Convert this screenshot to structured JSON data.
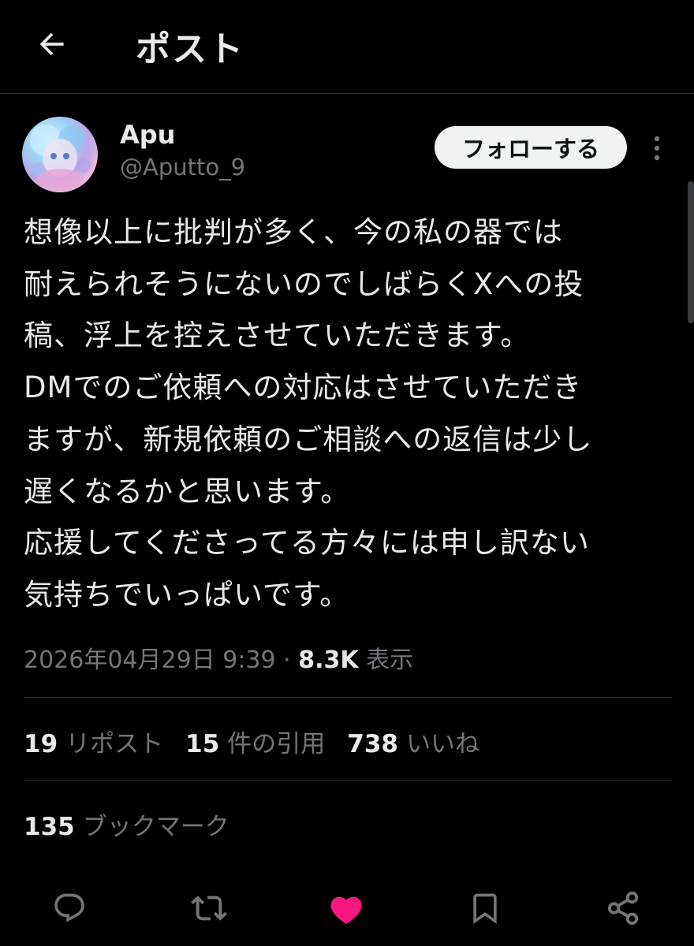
{
  "header": {
    "title": "ポスト",
    "back_icon": "arrow-left-icon"
  },
  "author": {
    "display_name": "Apu",
    "handle": "@Aputto_9",
    "follow_label": "フォローする",
    "more_icon": "more-vertical-icon"
  },
  "post": {
    "text": "想像以上に批判が多く、今の私の器では\n耐えられそうにないのでしばらくXへの投\n稿、浮上を控えさせていただきます。\nDMでのご依頼への対応はさせていただき\nますが、新規依頼のご相談への返信は少し\n遅くなるかと思います。\n応援してくださってる方々には申し訳ない\n気持ちでいっぱいです。",
    "timestamp": "2026年04月29日 9:39",
    "separator": " · ",
    "views_count": "8.3K",
    "views_label": "表示"
  },
  "stats": {
    "reposts_count": "19",
    "reposts_label": "リポスト",
    "quotes_count": "15",
    "quotes_label": "件の引用",
    "likes_count": "738",
    "likes_label": "いいね",
    "bookmarks_count": "135",
    "bookmarks_label": "ブックマーク"
  },
  "actions": [
    {
      "icon": "reply-icon"
    },
    {
      "icon": "repost-icon"
    },
    {
      "icon": "heart-filled-icon",
      "color": "#f91880"
    },
    {
      "icon": "bookmark-icon"
    },
    {
      "icon": "share-icon"
    }
  ],
  "colors": {
    "background": "#000000",
    "text_primary": "#e7e9ea",
    "text_secondary": "#71767b",
    "like_active": "#f91880",
    "divider": "#2f3336"
  }
}
